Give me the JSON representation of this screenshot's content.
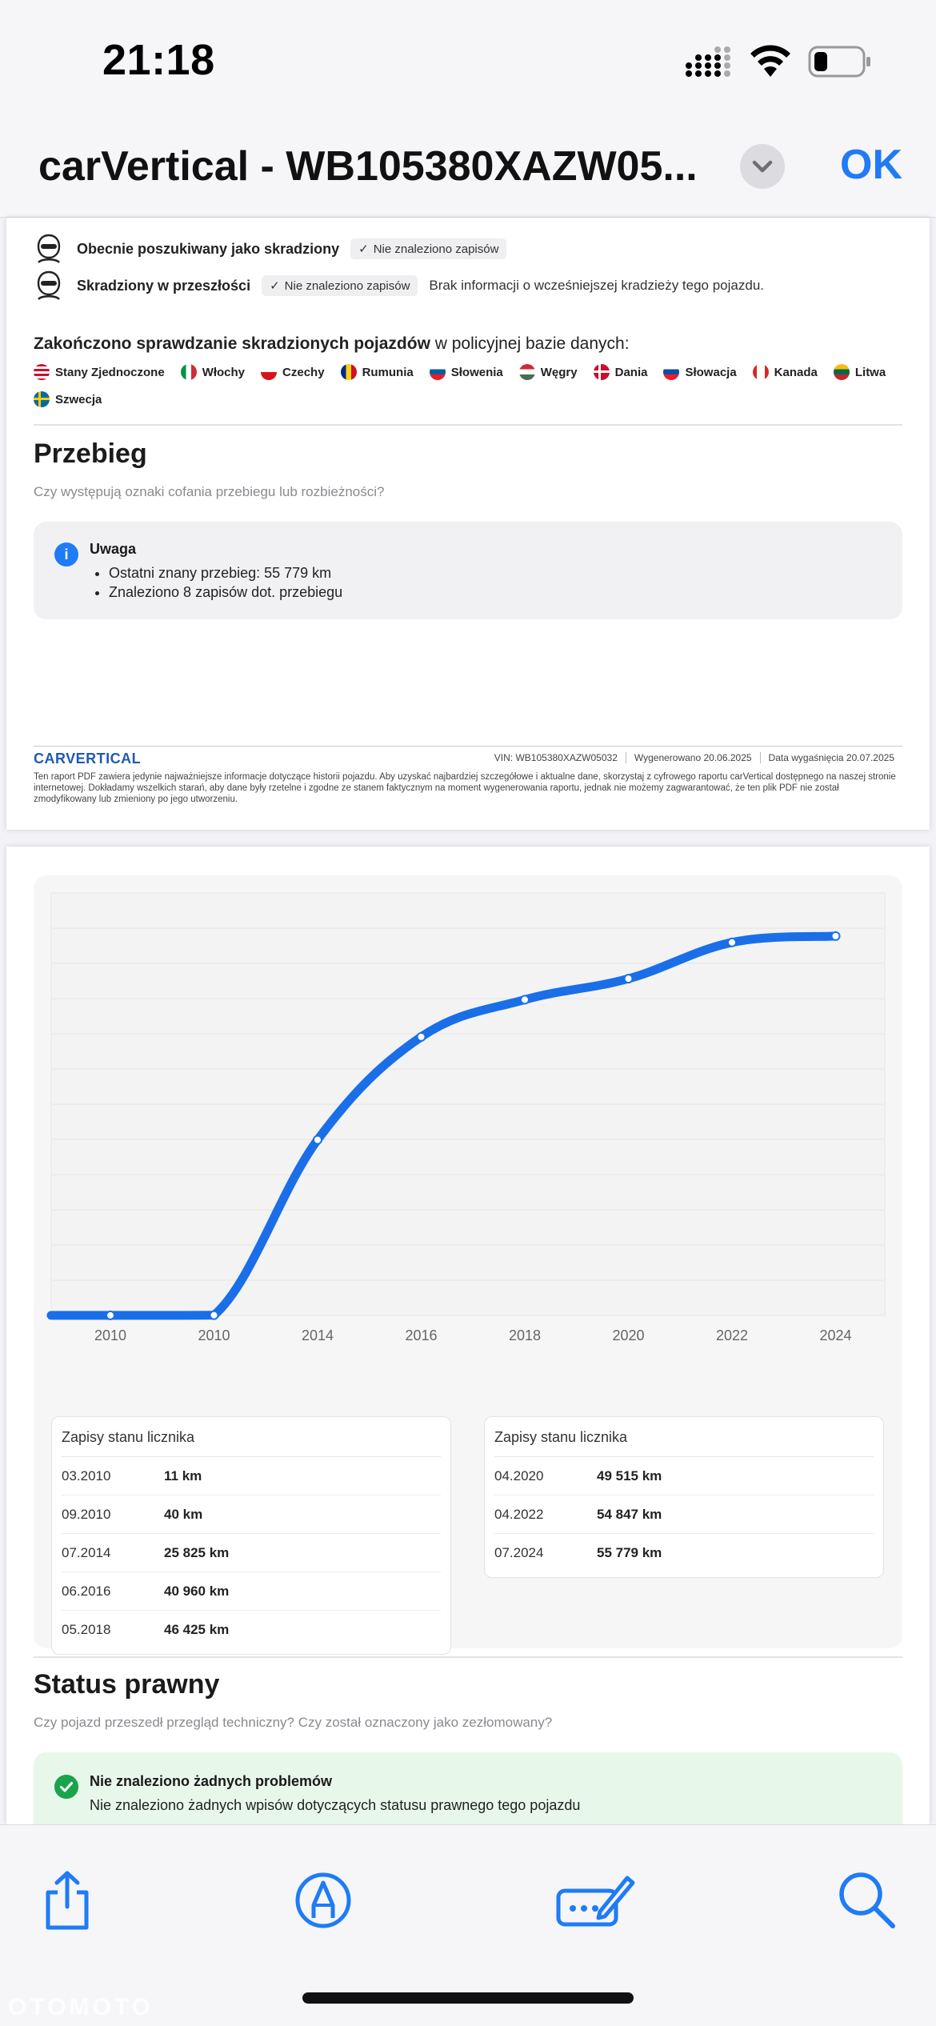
{
  "status": {
    "time": "21:18"
  },
  "nav": {
    "title": "carVertical - WB105380XAZW05...",
    "ok": "OK"
  },
  "theft": {
    "rows": [
      {
        "label": "Obecnie poszukiwany jako skradziony",
        "badge": "Nie znaleziono zapisów",
        "note": ""
      },
      {
        "label": "Skradziony w przeszłości",
        "badge": "Nie znaleziono zapisów",
        "note": "Brak informacji o wcześniejszej kradzieży tego pojazdu."
      }
    ],
    "db_check_bold": "Zakończono sprawdzanie skradzionych pojazdów",
    "db_check_rest": " w policyjnej bazie danych:",
    "countries": [
      "Stany Zjednoczone",
      "Włochy",
      "Czechy",
      "Rumunia",
      "Słowenia",
      "Węgry",
      "Dania",
      "Słowacja",
      "Kanada",
      "Litwa",
      "Szwecja"
    ]
  },
  "mileage": {
    "title": "Przebieg",
    "subtitle": "Czy występują oznaki cofania przebiegu lub rozbieżności?",
    "warning_title": "Uwaga",
    "warning_items": [
      "Ostatni znany przebieg: 55 779 km",
      "Znaleziono 8 zapisów dot. przebiegu"
    ]
  },
  "footer": {
    "logo": "CARVERTICAL",
    "vin": "VIN:  WB105380XAZW05032",
    "generated": "Wygenerowano  20.06.2025",
    "expires": "Data wygaśnięcia  20.07.2025",
    "disclaimer": "Ten raport PDF zawiera jedynie najważniejsze informacje dotyczące historii pojazdu. Aby uzyskać najbardziej szczegółowe i aktualne dane, skorzystaj z cyfrowego raportu carVertical dostępnego na naszej stronie internetowej. Dokładamy wszelkich starań, aby dane były rzetelne i zgodne ze stanem faktycznym na moment wygenerowania raportu, jednak nie możemy zagwarantować, że ten plik PDF nie został zmodyfikowany lub zmieniony po jego utworzeniu."
  },
  "chart_data": {
    "type": "line",
    "x": [
      "2010",
      "2010",
      "2014",
      "2016",
      "2018",
      "2020",
      "2022",
      "2024"
    ],
    "values": [
      11,
      40,
      25825,
      40960,
      46425,
      49515,
      54847,
      55779
    ],
    "title": "",
    "xlabel": "",
    "ylabel": "",
    "ylim": [
      0,
      56000
    ],
    "grid": true,
    "color": "#1a6fe8"
  },
  "records": {
    "header": "Zapisy stanu licznika",
    "left": [
      {
        "date": "03.2010",
        "value": "11 km"
      },
      {
        "date": "09.2010",
        "value": "40 km"
      },
      {
        "date": "07.2014",
        "value": "25 825 km"
      },
      {
        "date": "06.2016",
        "value": "40 960 km"
      },
      {
        "date": "05.2018",
        "value": "46 425 km"
      }
    ],
    "right": [
      {
        "date": "04.2020",
        "value": "49 515 km"
      },
      {
        "date": "04.2022",
        "value": "54 847 km"
      },
      {
        "date": "07.2024",
        "value": "55 779 km"
      }
    ]
  },
  "legal": {
    "title": "Status prawny",
    "subtitle": "Czy pojazd przeszedł przegląd techniczny? Czy został oznaczony jako zezłomowany?",
    "ok_title": "Nie znaleziono żadnych problemów",
    "ok_text": "Nie znaleziono żadnych wpisów dotyczących statusu prawnego tego pojazdu"
  },
  "watermark": "OTOMOTO",
  "colors": {
    "accent": "#1f7bf6",
    "success": "#19a44c"
  }
}
